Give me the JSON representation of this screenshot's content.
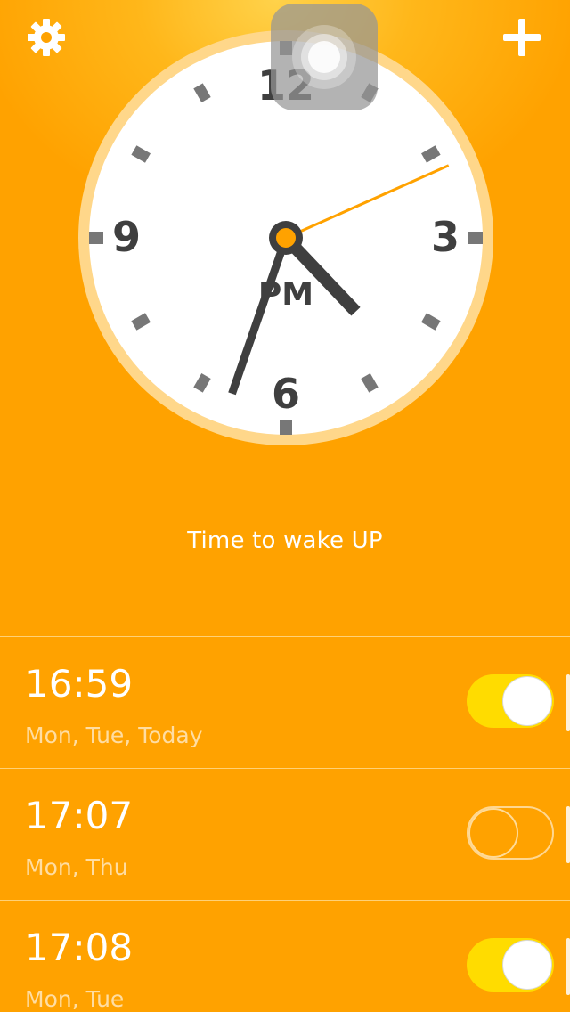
{
  "header": {
    "settings_icon": "gear-icon",
    "add_icon": "plus-icon"
  },
  "clock": {
    "numerals": {
      "twelve": "12",
      "three": "3",
      "six": "6",
      "nine": "9"
    },
    "period": "PM",
    "time": {
      "hour": 16,
      "minute": 33,
      "second": 11
    },
    "colors": {
      "face": "#FFFFFF",
      "rim": "#FFD78A",
      "hands": "#3F3F3F",
      "second_hand": "#FFA200",
      "ticks": "#777777"
    }
  },
  "assistive_touch": {
    "icon": "assistive-touch-icon"
  },
  "message": "Time to wake UP",
  "alarms": [
    {
      "time": "16:59",
      "days": "Mon, Tue, Today",
      "enabled": true
    },
    {
      "time": "17:07",
      "days": "Mon, Thu",
      "enabled": false
    },
    {
      "time": "17:08",
      "days": "Mon, Tue",
      "enabled": true
    }
  ],
  "colors": {
    "background": "#FFA200",
    "toggle_on": "#FFDC00",
    "text": "#FFFFFF"
  }
}
